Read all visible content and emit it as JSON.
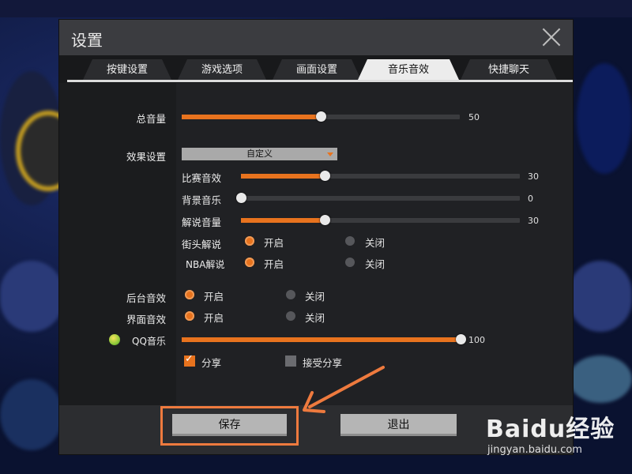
{
  "dialog": {
    "title": "设置",
    "tabs": [
      {
        "label": "按键设置",
        "active": false
      },
      {
        "label": "游戏选项",
        "active": false
      },
      {
        "label": "画面设置",
        "active": false
      },
      {
        "label": "音乐音效",
        "active": true
      },
      {
        "label": "快捷聊天",
        "active": false
      }
    ]
  },
  "audio": {
    "master_volume": {
      "label": "总音量",
      "value": "50",
      "fraction": 0.5
    },
    "effects": {
      "label": "效果设置",
      "preset": "自定义",
      "match_sfx": {
        "label": "比赛音效",
        "value": "30",
        "fraction": 0.3
      },
      "bgm": {
        "label": "背景音乐",
        "value": "0",
        "fraction": 0.0
      },
      "commentary": {
        "label": "解说音量",
        "value": "30",
        "fraction": 0.3
      },
      "street_commentary": {
        "label": "街头解说",
        "on_label": "开启",
        "off_label": "关闭",
        "selected": "on"
      },
      "nba_commentary": {
        "label": "NBA解说",
        "on_label": "开启",
        "off_label": "关闭",
        "selected": "on"
      }
    },
    "background_sfx": {
      "label": "后台音效",
      "on_label": "开启",
      "off_label": "关闭",
      "selected": "on"
    },
    "ui_sfx": {
      "label": "界面音效",
      "on_label": "开启",
      "off_label": "关闭",
      "selected": "on"
    },
    "qq_music": {
      "label": "QQ音乐",
      "value": "100",
      "fraction": 1.0
    },
    "share": {
      "label": "分享",
      "checked": true
    },
    "accept_share": {
      "label": "接受分享",
      "checked": false
    }
  },
  "footer": {
    "save_label": "保存",
    "exit_label": "退出"
  },
  "watermark": {
    "brand": "Baidu经验",
    "url": "jingyan.baidu.com"
  },
  "colors": {
    "accent": "#e8731e",
    "annotation": "#ee7a3e"
  }
}
